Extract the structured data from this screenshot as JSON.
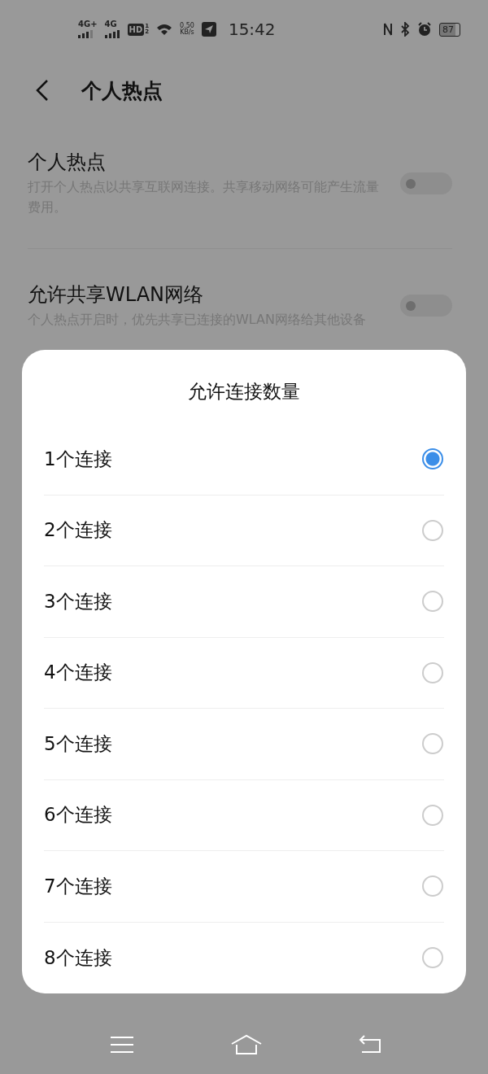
{
  "status_bar": {
    "signal_1": "4G+",
    "signal_2": "4G",
    "hd": "HD",
    "hd_sim": "1",
    "hd_sim_2": "2",
    "speed": "0.50",
    "speed_unit": "KB/s",
    "time": "15:42",
    "battery": "87"
  },
  "header": {
    "title": "个人热点"
  },
  "settings": [
    {
      "title": "个人热点",
      "description": "打开个人热点以共享互联网连接。共享移动网络可能产生流量费用。",
      "on": false
    },
    {
      "title": "允许共享WLAN网络",
      "description": "个人热点开启时，优先共享已连接的WLAN网络给其他设备",
      "on": false
    }
  ],
  "dialog": {
    "title": "允许连接数量",
    "options": [
      {
        "label": "1个连接",
        "selected": true
      },
      {
        "label": "2个连接",
        "selected": false
      },
      {
        "label": "3个连接",
        "selected": false
      },
      {
        "label": "4个连接",
        "selected": false
      },
      {
        "label": "5个连接",
        "selected": false
      },
      {
        "label": "6个连接",
        "selected": false
      },
      {
        "label": "7个连接",
        "selected": false
      },
      {
        "label": "8个连接",
        "selected": false
      }
    ]
  }
}
